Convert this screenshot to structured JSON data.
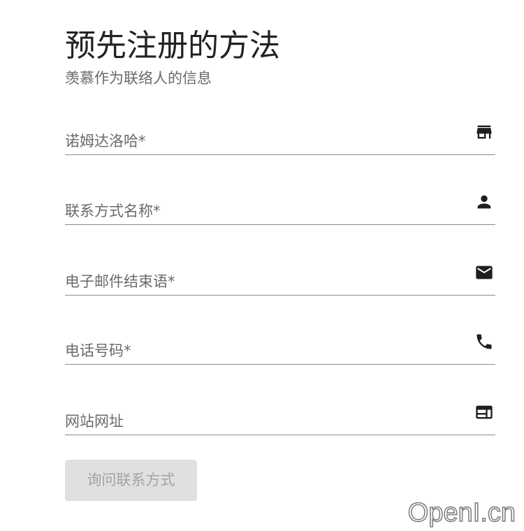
{
  "header": {
    "title": "预先注册的方法",
    "subtitle": "羡慕作为联络人的信息"
  },
  "form": {
    "fields": [
      {
        "label": "诺姆达洛哈*",
        "icon": "store-icon"
      },
      {
        "label": "联系方式名称*",
        "icon": "person-icon"
      },
      {
        "label": "电子邮件结束语*",
        "icon": "mail-icon"
      },
      {
        "label": "电话号码*",
        "icon": "phone-icon"
      },
      {
        "label": "网站网址",
        "icon": "web-icon"
      }
    ],
    "submit_label": "询问联系方式"
  },
  "watermark": "OpenI.cn",
  "colors": {
    "title": "#222222",
    "label": "#6a6a6a",
    "underline": "#8a8a8a",
    "icon": "#1f1f1f",
    "button_bg": "#e0e0e0",
    "button_text": "#a3a3a3"
  }
}
